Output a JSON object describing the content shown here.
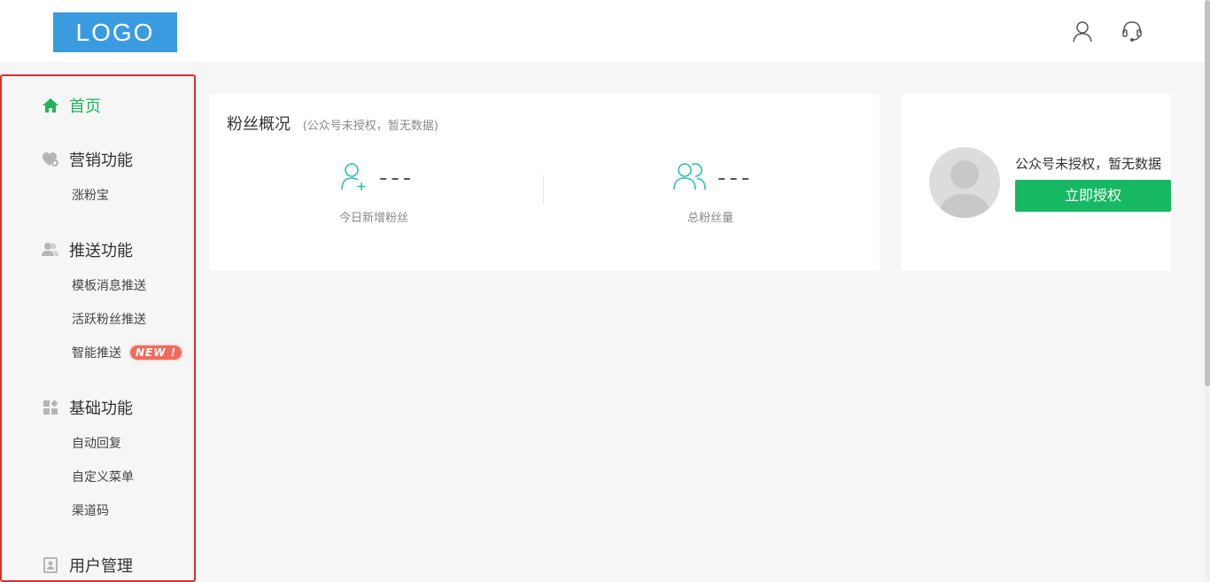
{
  "header": {
    "logo_text": "LOGO",
    "icons": [
      "user-icon",
      "headset-icon"
    ]
  },
  "sidebar": {
    "home": {
      "label": "首页",
      "icon": "home-icon",
      "active": true
    },
    "groups": [
      {
        "label": "营销功能",
        "icon": "heart-plus-icon",
        "items": [
          {
            "label": "涨粉宝"
          }
        ]
      },
      {
        "label": "推送功能",
        "icon": "users-icon",
        "items": [
          {
            "label": "模板消息推送"
          },
          {
            "label": "活跃粉丝推送"
          },
          {
            "label": "智能推送",
            "badge": "NEW !"
          }
        ]
      },
      {
        "label": "基础功能",
        "icon": "grid-icon",
        "items": [
          {
            "label": "自动回复"
          },
          {
            "label": "自定义菜单"
          },
          {
            "label": "渠道码"
          }
        ]
      },
      {
        "label": "用户管理",
        "icon": "id-card-icon",
        "items": []
      }
    ],
    "colors": {
      "active": "#22b35a",
      "highlight_border": "#e02c2c"
    }
  },
  "fans_overview": {
    "title": "粉丝概况",
    "subtitle": "(公众号未授权，暂无数据)",
    "stats": [
      {
        "value": "---",
        "label": "今日新增粉丝",
        "icon": "add-user-icon"
      },
      {
        "value": "---",
        "label": "总粉丝量",
        "icon": "users-icon"
      }
    ]
  },
  "auth_card": {
    "message": "公众号未授权，暂无数据",
    "button_label": "立即授权",
    "colors": {
      "button": "#16b863"
    }
  }
}
